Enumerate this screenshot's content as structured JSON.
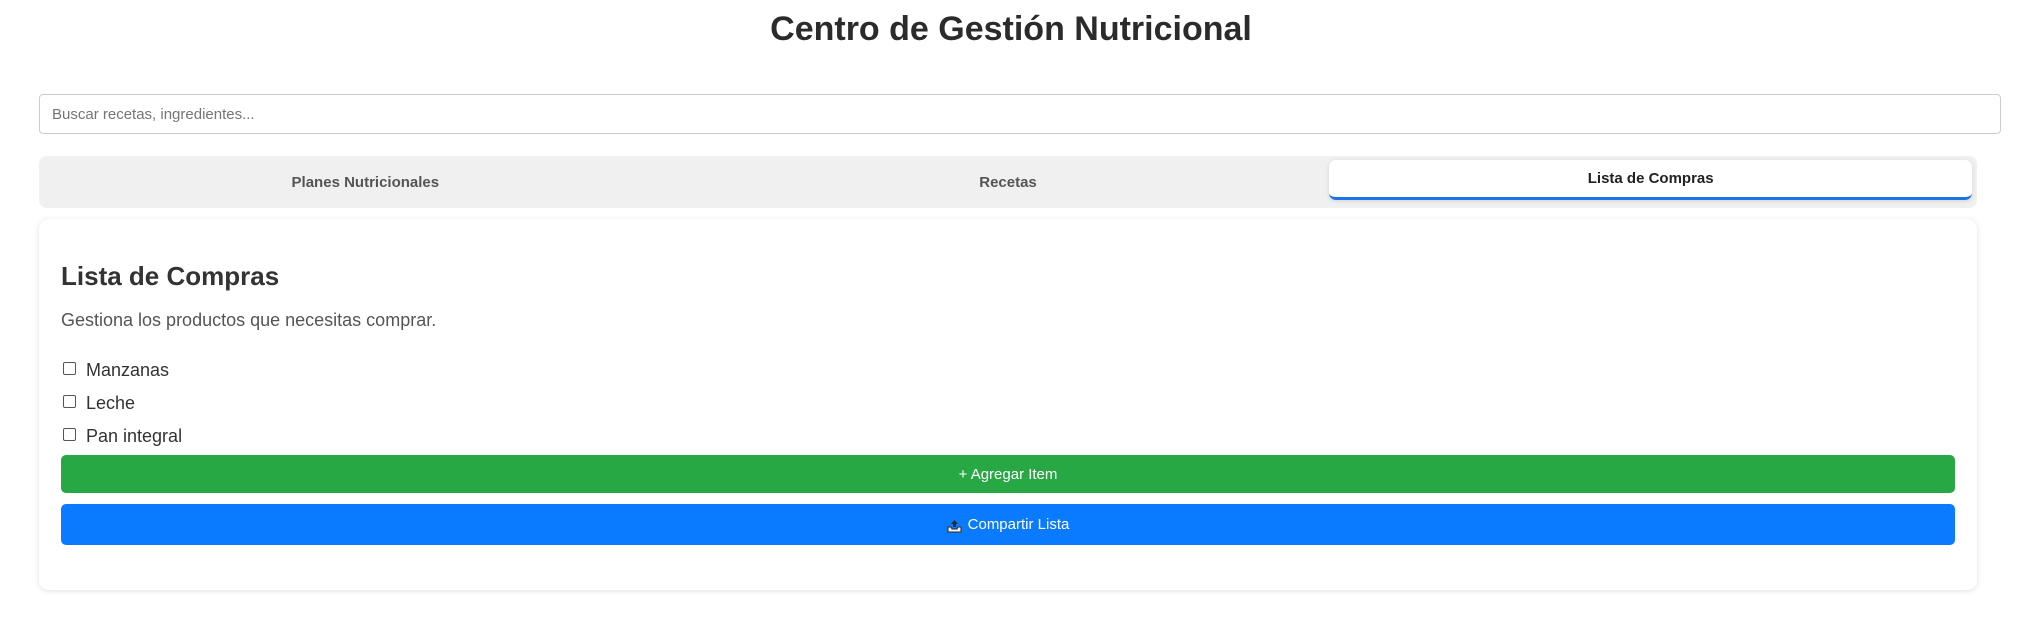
{
  "header": {
    "title": "Centro de Gestión Nutricional"
  },
  "search": {
    "placeholder": "Buscar recetas, ingredientes..."
  },
  "tabs": [
    {
      "label": "Planes Nutricionales",
      "active": false
    },
    {
      "label": "Recetas",
      "active": false
    },
    {
      "label": "Lista de Compras",
      "active": true
    }
  ],
  "shopping_list": {
    "title": "Lista de Compras",
    "description": "Gestiona los productos que necesitas comprar.",
    "items": [
      {
        "label": "Manzanas",
        "checked": false
      },
      {
        "label": "Leche",
        "checked": false
      },
      {
        "label": "Pan integral",
        "checked": false
      }
    ],
    "add_button_label": "+ Agregar Item",
    "share_button_label": "Compartir Lista",
    "share_icon": "outbox-tray-icon"
  },
  "colors": {
    "add_button": "#28a745",
    "share_button": "#0a7bff",
    "active_tab_underline": "#1a73e8"
  }
}
